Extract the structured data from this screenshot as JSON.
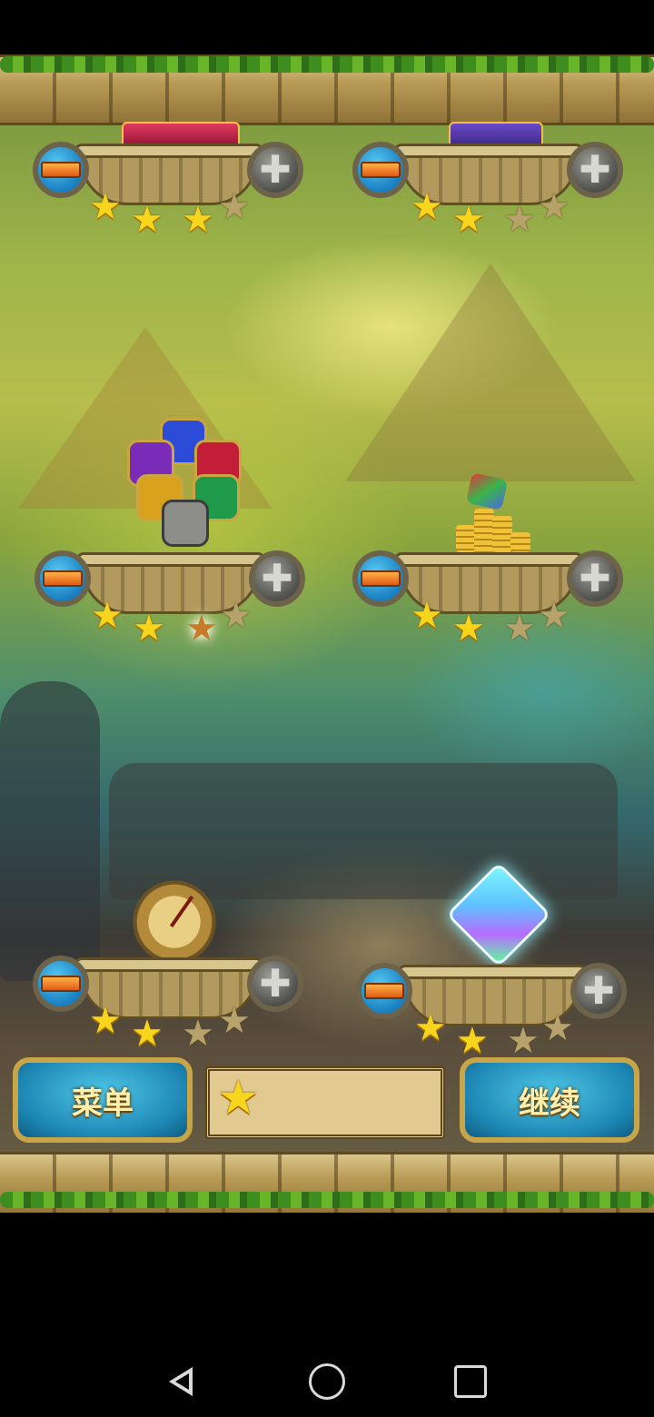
{
  "buttons": {
    "menu_label": "菜单",
    "continue_label": "继续"
  },
  "star_panel": {
    "count_text": ""
  },
  "pedestals": [
    {
      "name": "row1-left",
      "stars_filled": 3,
      "stars_total": 4
    },
    {
      "name": "row1-right",
      "stars_filled": 2,
      "stars_total": 4
    },
    {
      "name": "row2-left",
      "stars_filled": 2,
      "stars_total": 4
    },
    {
      "name": "row2-right",
      "stars_filled": 2,
      "stars_total": 4
    },
    {
      "name": "row3-left",
      "stars_filled": 2,
      "stars_total": 4
    },
    {
      "name": "row3-right",
      "stars_filled": 2,
      "stars_total": 4
    }
  ],
  "icons": {
    "minus": "minus-icon",
    "plus": "plus-icon",
    "star": "star-icon",
    "back": "back-icon",
    "home": "home-icon",
    "recents": "recents-icon"
  },
  "colors": {
    "button_blue": "#1d86b3",
    "gold": "#c9a54a",
    "star_gold": "#f7d51c"
  }
}
